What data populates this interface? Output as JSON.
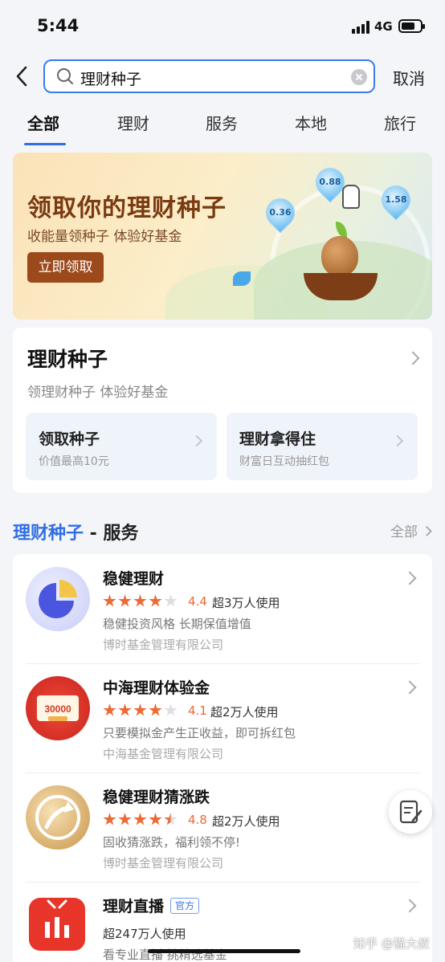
{
  "status_bar": {
    "time": "5:44",
    "network": "4G"
  },
  "search": {
    "query": "理财种子",
    "cancel_label": "取消"
  },
  "tabs": [
    {
      "label": "全部",
      "active": true
    },
    {
      "label": "理财",
      "active": false
    },
    {
      "label": "服务",
      "active": false
    },
    {
      "label": "本地",
      "active": false
    },
    {
      "label": "旅行",
      "active": false
    }
  ],
  "banner": {
    "title": "领取你的理财种子",
    "subtitle": "收能量领种子 体验好基金",
    "button_label": "立即领取",
    "drops": [
      "0.36",
      "0.88",
      "1.58"
    ]
  },
  "feature_card": {
    "title": "理财种子",
    "subtitle": "领理财种子 体验好基金",
    "subcards": [
      {
        "title": "领取种子",
        "subtitle": "价值最高10元"
      },
      {
        "title": "理财拿得住",
        "subtitle": "财富日互动抽红包"
      }
    ]
  },
  "section": {
    "keyword": "理财种子",
    "rest": " - 服务",
    "all_label": "全部"
  },
  "services": [
    {
      "name": "稳健理财",
      "rating": "4.4",
      "stars": 4,
      "users": "超3万人使用",
      "desc": "稳健投资风格 长期保值增值",
      "provider": "博时基金管理有限公司"
    },
    {
      "name": "中海理财体验金",
      "rating": "4.1",
      "stars": 4,
      "users": "超2万人使用",
      "desc": "只要模拟金产生正收益，即可拆红包",
      "provider": "中海基金管理有限公司"
    },
    {
      "name": "稳健理财猜涨跌",
      "rating": "4.8",
      "stars": 4.5,
      "users": "超2万人使用",
      "desc": "固收猜涨跌，福利领不停!",
      "provider": "博时基金管理有限公司"
    },
    {
      "name": "理财直播",
      "badge": "官方",
      "users": "超247万人使用",
      "desc": "看专业直播 挑精选基金"
    }
  ],
  "watermark": "知乎 @猫大叔",
  "colors": {
    "accent": "#2f6ee6",
    "star": "#ee6a33",
    "banner_button": "#9c4a1b"
  }
}
